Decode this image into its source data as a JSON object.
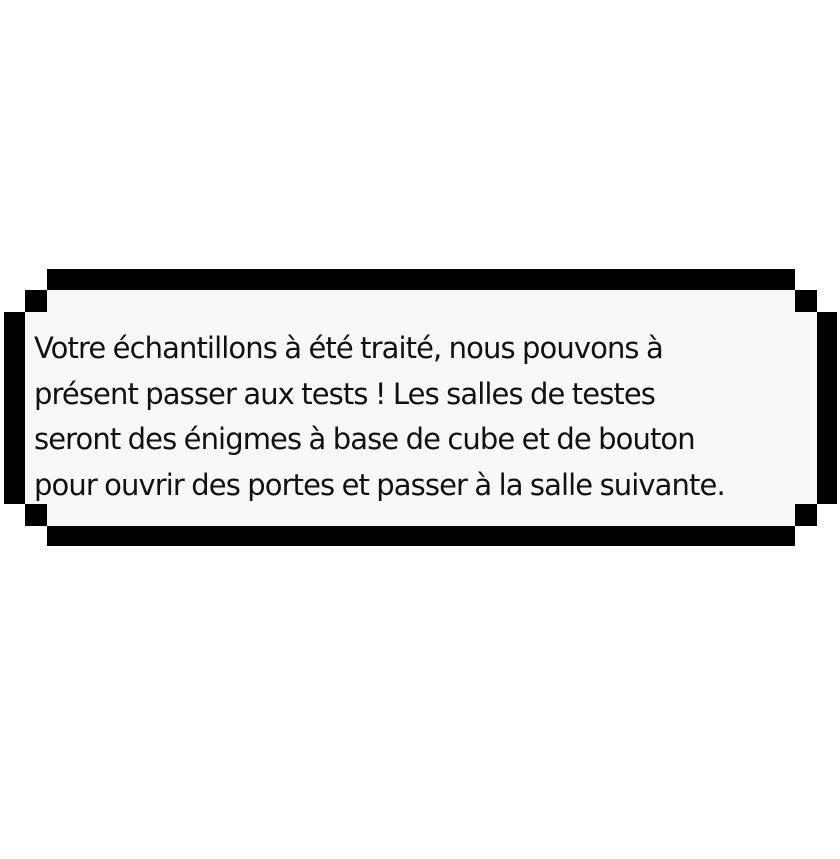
{
  "dialog": {
    "lines": [
      "Votre échantillons à été traité, nous pouvons à",
      "présent passer aux tests ! Les salles de testes",
      "seront des énigmes à base de cube et de bouton",
      "pour ouvrir des portes et passer à la salle suivante."
    ]
  }
}
